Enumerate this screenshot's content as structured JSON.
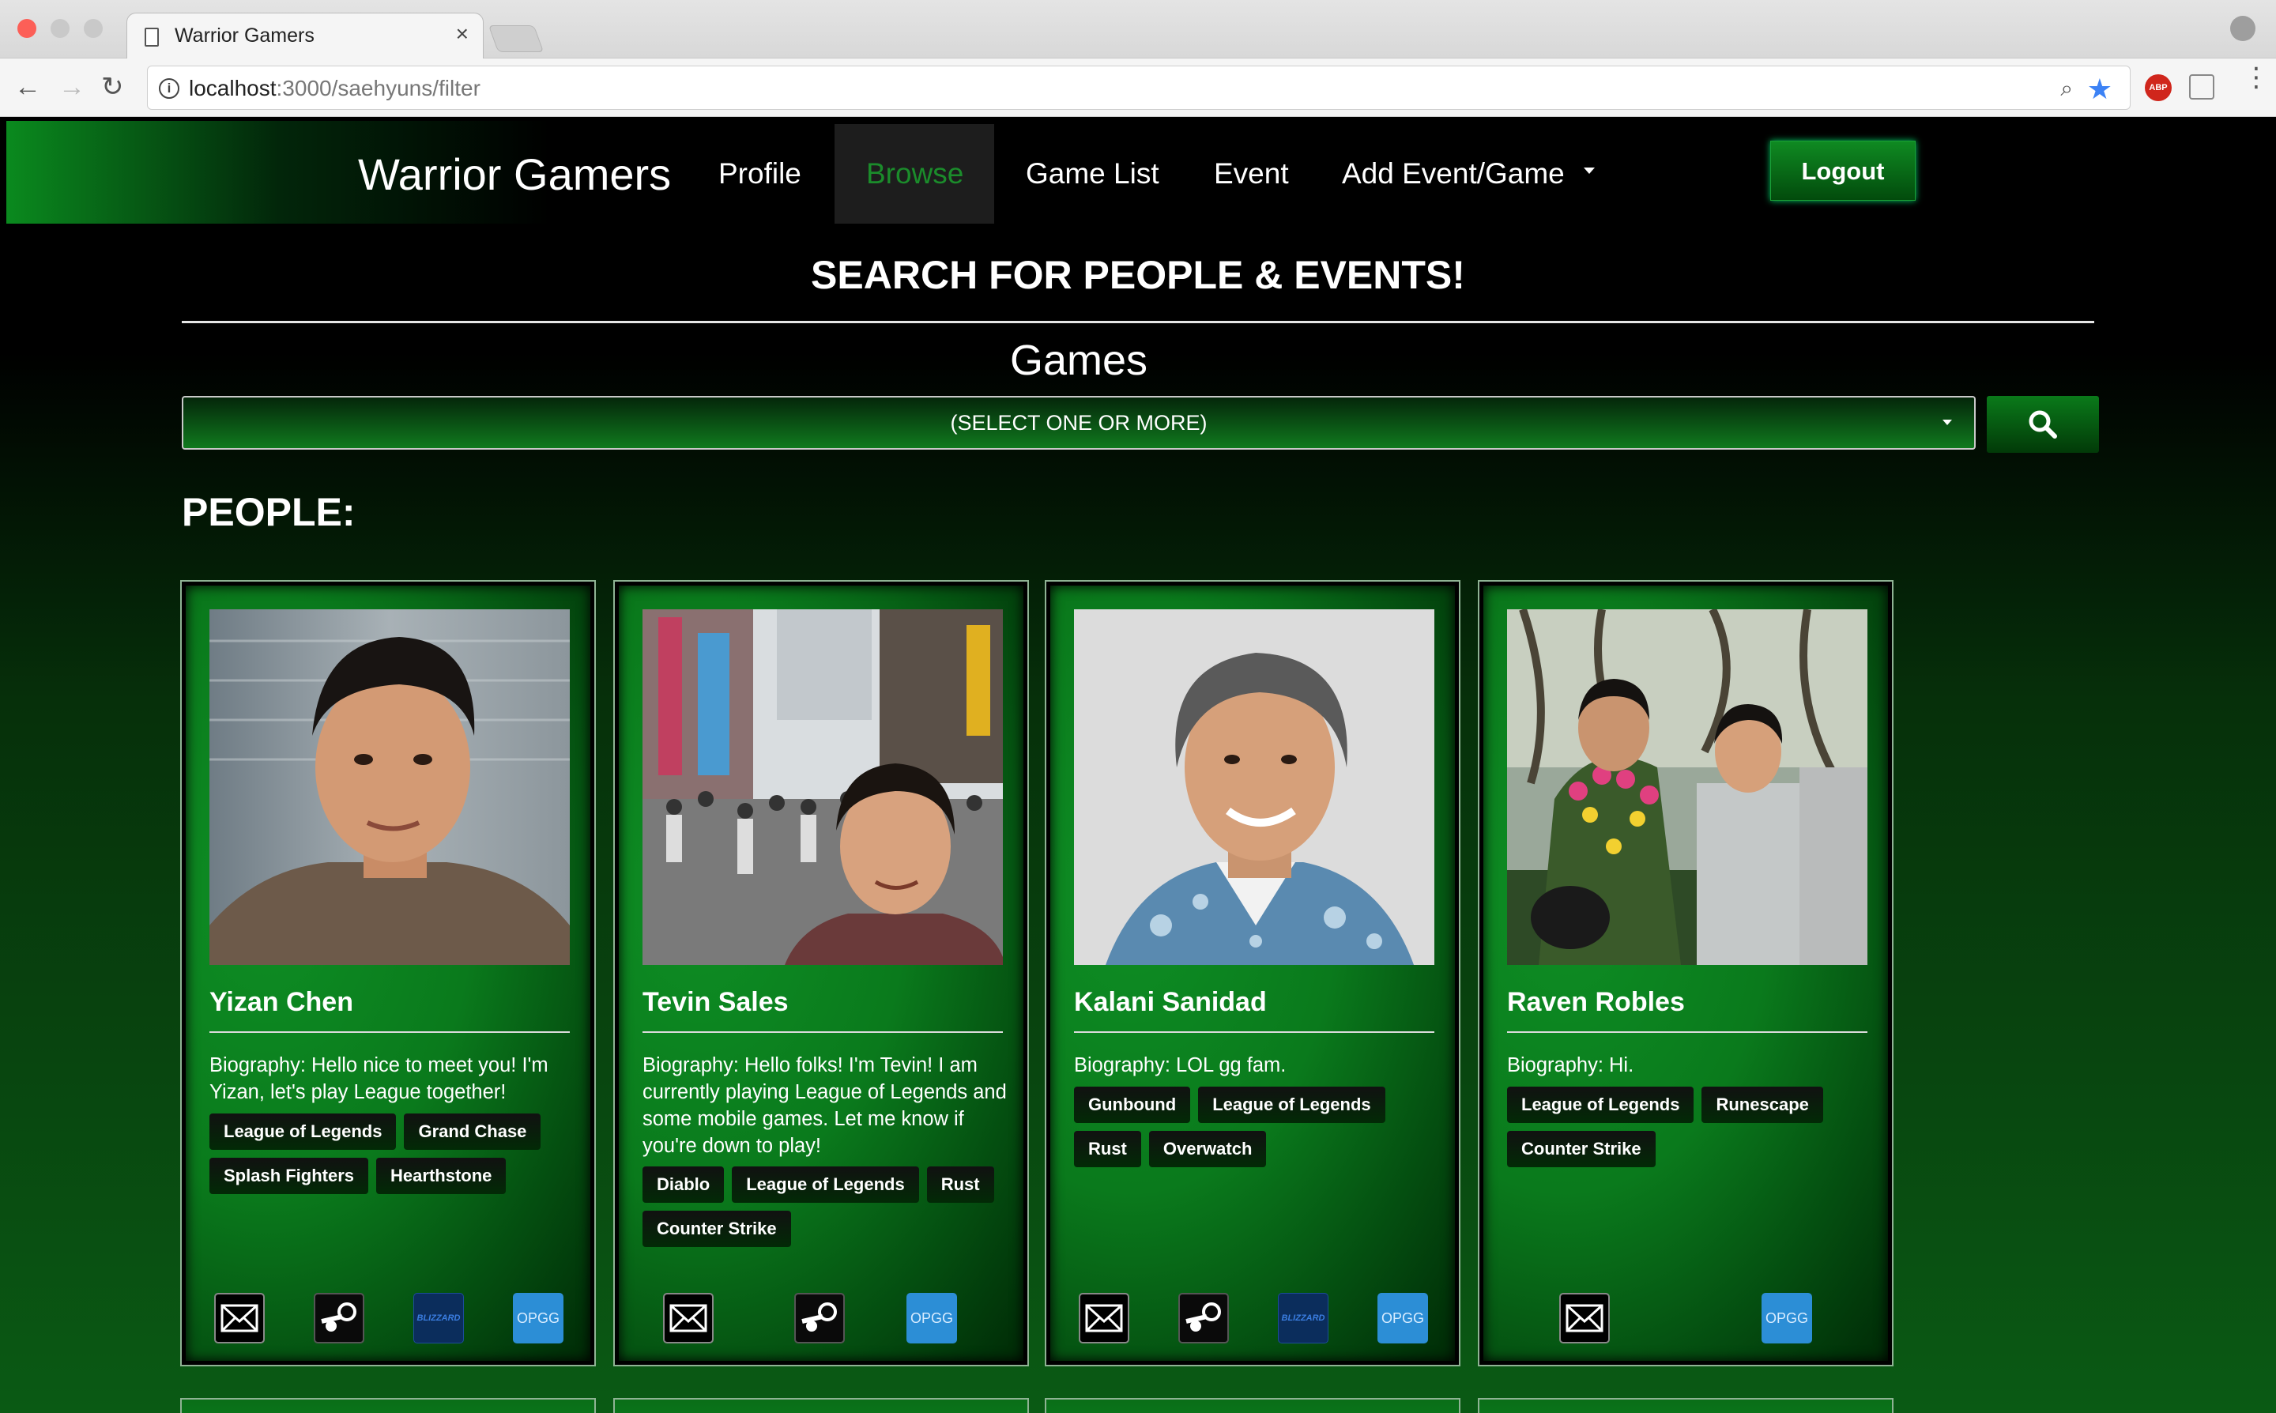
{
  "browser": {
    "tab_title": "Warrior Gamers",
    "tab_close": "×",
    "url_host": "localhost",
    "url_path": ":3000/saehyuns/filter",
    "abp_label": "ABP",
    "back": "←",
    "forward": "→",
    "reload": "↻",
    "info": "i",
    "zoom": "⌕",
    "star": "★",
    "menu": "⋮"
  },
  "navbar": {
    "brand": "Warrior Gamers",
    "links": [
      "Profile",
      "Browse",
      "Game List",
      "Event",
      "Add Event/Game"
    ],
    "active": "Browse",
    "logout": "Logout"
  },
  "search": {
    "headline": "SEARCH FOR PEOPLE & EVENTS!",
    "games_label": "Games",
    "select_placeholder": "(SELECT ONE OR MORE)"
  },
  "people_label": "PEOPLE:",
  "people": [
    {
      "name": "Yizan Chen",
      "bio": "Biography: Hello nice to meet you! I'm Yizan, let's play League together!",
      "tags": [
        "League of Legends",
        "Grand Chase",
        "Splash Fighters",
        "Hearthstone"
      ],
      "icons": [
        "mail-icon",
        "steam-icon",
        "blizzard-icon",
        "opgg-icon"
      ]
    },
    {
      "name": "Tevin Sales",
      "bio": "Biography: Hello folks! I'm Tevin! I am currently playing League of Legends and some mobile games. Let me know if you're down to play!",
      "tags": [
        "Diablo",
        "League of Legends",
        "Rust",
        "Counter Strike"
      ],
      "icons": [
        "mail-icon",
        "steam-icon",
        "opgg-icon"
      ]
    },
    {
      "name": "Kalani Sanidad",
      "bio": "Biography: LOL gg fam.",
      "tags": [
        "Gunbound",
        "League of Legends",
        "Rust",
        "Overwatch"
      ],
      "icons": [
        "mail-icon",
        "steam-icon",
        "blizzard-icon",
        "opgg-icon"
      ]
    },
    {
      "name": "Raven Robles",
      "bio": "Biography: Hi.",
      "tags": [
        "League of Legends",
        "Runescape",
        "Counter Strike"
      ],
      "icons": [
        "mail-icon",
        "opgg-icon"
      ]
    }
  ],
  "icon_labels": {
    "blizzard": "BLIZZARD",
    "opgg": "OPGG"
  },
  "colors": {
    "accent_green": "#0a7a1c",
    "active_link": "#1b8c2b",
    "opgg_blue": "#2c8ed6"
  }
}
